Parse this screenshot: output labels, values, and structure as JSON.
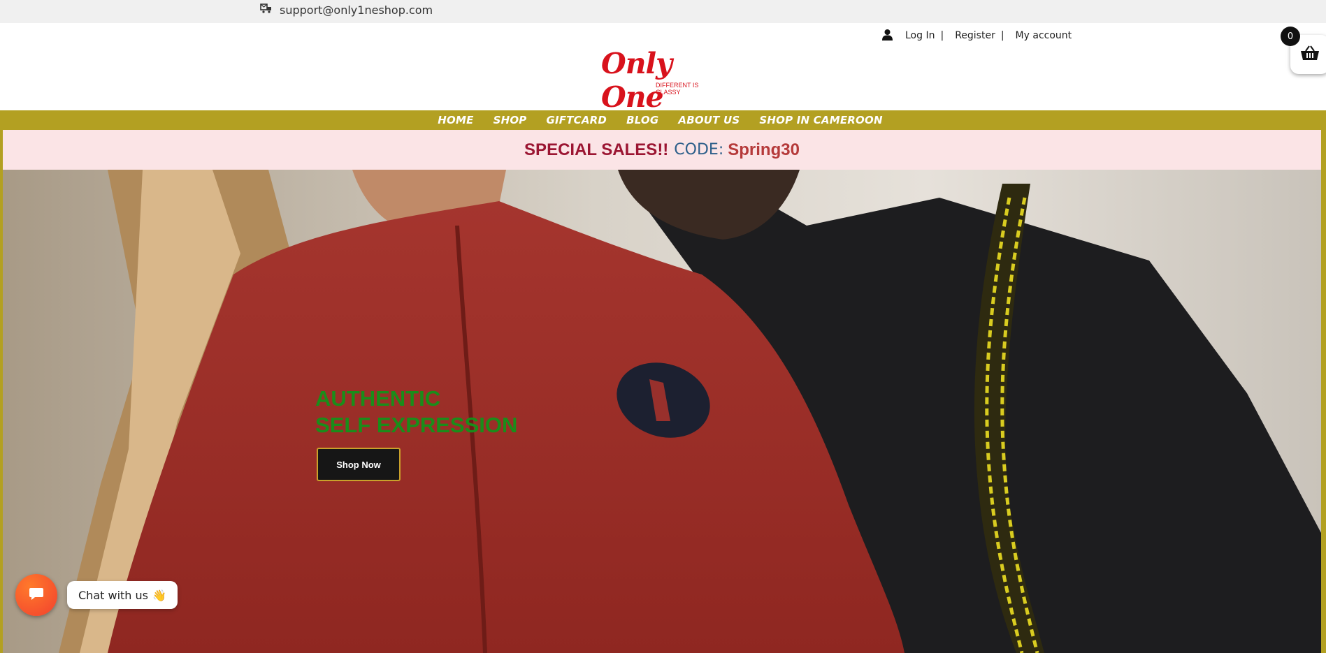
{
  "topbar": {
    "email": "support@only1neshop.com",
    "email_icon": "envelope-truck-icon"
  },
  "header": {
    "account_links": {
      "login": "Log In",
      "register": "Register",
      "my_account": "My account",
      "separator": "|"
    },
    "logo": {
      "main": "Only One",
      "tagline": "DIFFERENT IS CLASSY"
    },
    "cart": {
      "count": "0",
      "icon": "basket-icon"
    }
  },
  "nav": {
    "items": [
      {
        "label": "HOME"
      },
      {
        "label": "SHOP"
      },
      {
        "label": "GIFTCARD"
      },
      {
        "label": "BLOG"
      },
      {
        "label": "ABOUT US"
      },
      {
        "label": "SHOP IN CAMEROON"
      }
    ]
  },
  "promo": {
    "part1": "SPECIAL SALES!!",
    "part2": "CODE:",
    "part3": "Spring30"
  },
  "hero": {
    "title_line1": "AUTHENTIC",
    "title_line2": "SELF EXPRESSION",
    "button_label": "Shop Now"
  },
  "chat": {
    "label": "Chat with us",
    "emoji": "👋"
  },
  "colors": {
    "nav_bar": "#b3a022",
    "promo_bg": "#fbe4e6",
    "brand_red": "#d8121c",
    "hero_title": "#1a8d1a",
    "chat_fab": "#f2402e"
  }
}
